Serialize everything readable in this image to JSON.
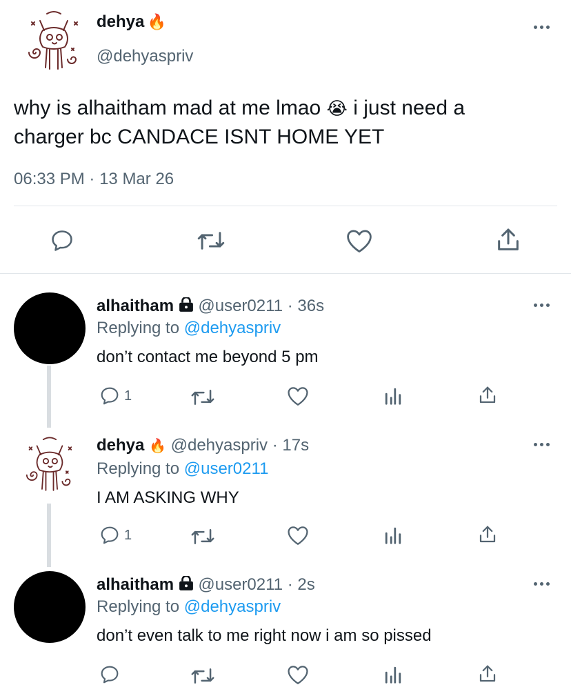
{
  "main_tweet": {
    "name": "dehya",
    "name_emoji": "🔥",
    "handle": "@dehyaspriv",
    "text_line1": "why is alhaitham mad at me lmao",
    "emoji": "😭",
    "text_line1b": "i just need a",
    "text_line2": "charger bc CANDACE ISNT HOME YET",
    "time": "06:33 PM",
    "sep": "·",
    "date": "13 Mar 26"
  },
  "replies": [
    {
      "name": "alhaitham",
      "handle": "@user0211",
      "sep": "·",
      "age": "36s",
      "replying_label": "Replying to",
      "replying_to": "@dehyaspriv",
      "text": "don’t contact me beyond 5 pm",
      "reply_count": "1"
    },
    {
      "name": "dehya",
      "name_emoji": "🔥",
      "handle": "@dehyaspriv",
      "sep": "·",
      "age": "17s",
      "replying_label": "Replying to",
      "replying_to": "@user0211",
      "text": "I AM ASKING WHY",
      "reply_count": "1"
    },
    {
      "name": "alhaitham",
      "handle": "@user0211",
      "sep": "·",
      "age": "2s",
      "replying_label": "Replying to",
      "replying_to": "@dehyaspriv",
      "text": "don’t even talk to me right now i am so pissed"
    }
  ],
  "colors": {
    "link": "#1d9bf0",
    "muted": "#536471",
    "text": "#0f1419",
    "divider": "#e1e6ea"
  },
  "icons": [
    "reply-icon",
    "retweet-icon",
    "like-icon",
    "analytics-icon",
    "share-icon",
    "lock-icon",
    "more-icon"
  ]
}
